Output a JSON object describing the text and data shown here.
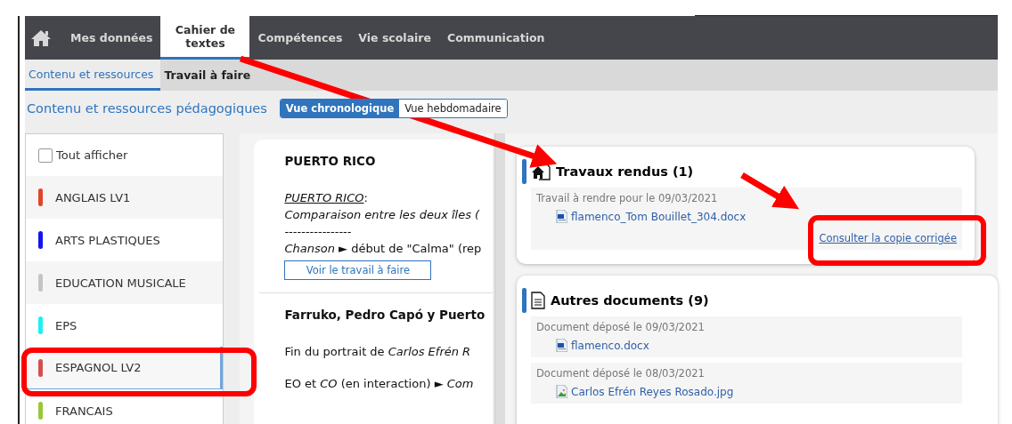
{
  "nav": {
    "items": [
      {
        "label": "Mes données",
        "selected": false
      },
      {
        "label": "Cahier de textes",
        "selected": true
      },
      {
        "label": "Compétences",
        "selected": false
      },
      {
        "label": "Vie scolaire",
        "selected": false
      },
      {
        "label": "Communication",
        "selected": false
      }
    ]
  },
  "subtabs": [
    {
      "label": "Contenu et ressources",
      "selected": true
    },
    {
      "label": "Travail à faire",
      "selected": false
    }
  ],
  "section": {
    "title": "Contenu et ressources pédagogiques",
    "views": [
      {
        "label": "Vue chronologique",
        "selected": true
      },
      {
        "label": "Vue hebdomadaire",
        "selected": false
      }
    ]
  },
  "subjects": {
    "show_all": {
      "label": "Tout afficher",
      "checked": false
    },
    "items": [
      {
        "name": "ANGLAIS LV1",
        "color": "#e0452b",
        "selected": false
      },
      {
        "name": "ARTS PLASTIQUES",
        "color": "#1414ee",
        "selected": false
      },
      {
        "name": "EDUCATION MUSICALE",
        "color": "#c4c4c4",
        "selected": false
      },
      {
        "name": "EPS",
        "color": "#1cf0f0",
        "selected": false
      },
      {
        "name": "ESPAGNOL LV2",
        "color": "#d2504c",
        "selected": true
      },
      {
        "name": "FRANCAIS",
        "color": "#9ac832",
        "selected": false
      }
    ]
  },
  "lessons": [
    {
      "title": "PUERTO RICO",
      "lines": [
        {
          "kind": "underlined",
          "text": "PUERTO RICO",
          "tail": ":"
        },
        {
          "kind": "plain",
          "text": "*Comparaison entre les deux îles (*"
        },
        {
          "kind": "plain",
          "text": "----------------"
        },
        {
          "kind": "plain",
          "text": "*Chanson* ► début de \"Calma\" (rep"
        }
      ],
      "button": "Voir le travail à faire"
    },
    {
      "title": "Farruko, Pedro Capó y Puerto",
      "lines": [
        {
          "kind": "spaced",
          "text": "Fin du portrait de *Carlos Efrén R*"
        },
        {
          "kind": "spaced",
          "text": "EO et *CO* (en interaction) ► *Com*"
        }
      ]
    }
  ],
  "submitted": {
    "title": "Travaux rendus (1)",
    "groups": [
      {
        "caption": "Travail à rendre pour le 09/03/2021",
        "files": [
          {
            "name": "flamenco_Tom Bouillet_304.docx",
            "kind": "word"
          }
        ],
        "link": "Consulter la copie corrigée"
      }
    ]
  },
  "documents": {
    "title": "Autres documents (9)",
    "groups": [
      {
        "caption": "Document déposé le 09/03/2021",
        "files": [
          {
            "name": "flamenco.docx",
            "kind": "word"
          }
        ]
      },
      {
        "caption": "Document déposé le 08/03/2021",
        "files": [
          {
            "name": "Carlos Efrén Reyes Rosado.jpg",
            "kind": "image"
          }
        ]
      }
    ]
  }
}
